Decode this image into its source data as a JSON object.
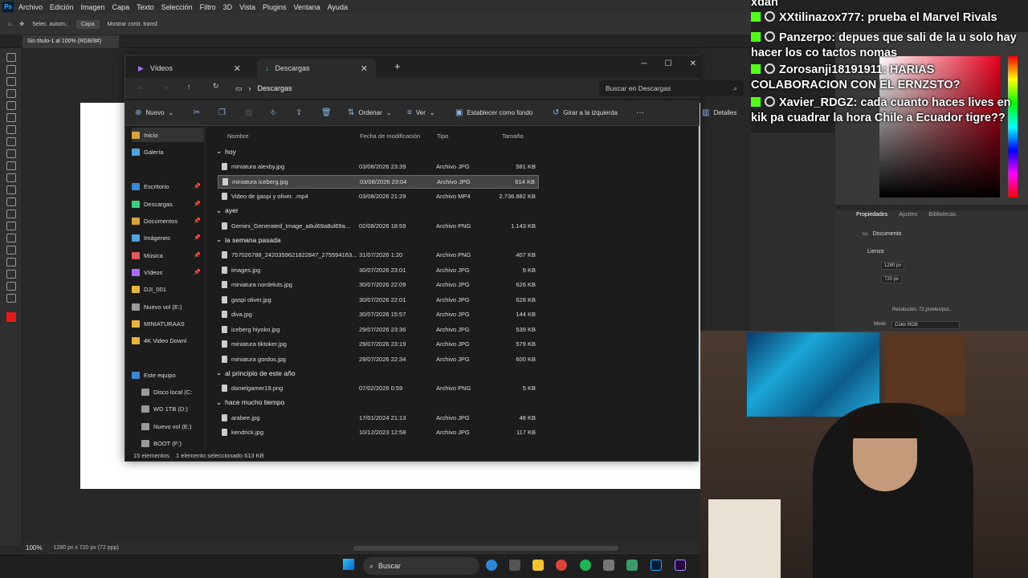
{
  "photoshop": {
    "menu": [
      "Archivo",
      "Edición",
      "Imagen",
      "Capa",
      "Texto",
      "Selección",
      "Filtro",
      "3D",
      "Vista",
      "Plugins",
      "Ventana",
      "Ayuda"
    ],
    "options": {
      "auto_select": "Selec. autom.:",
      "layer_select": "Capa",
      "show_transform": "Mostrar contr. transf."
    },
    "doc_tab": "Sin título-1 al 100% (RGB/8#)",
    "status_zoom": "100%",
    "status_info": "1280 px x 720 px (72 ppp)",
    "properties": {
      "tabs": [
        "Propiedades",
        "Ajustes",
        "Bibliotecas"
      ],
      "document": "Documento",
      "canvas": "Lienzo",
      "width": "1280 px",
      "height": "720 px",
      "resolution": "Resolución: 72 píxeles/pul...",
      "mode_label": "Modo",
      "mode_value": "Color RGB"
    }
  },
  "explorer": {
    "tabs": [
      {
        "label": "Vídeos"
      },
      {
        "label": "Descargas"
      }
    ],
    "breadcrumb": "Descargas",
    "search_placeholder": "Buscar en Descargas",
    "commands": {
      "new": "Nuevo",
      "sort": "Ordenar",
      "view": "Ver",
      "set_background": "Establecer como fondo",
      "rotate_left": "Girar a la izquierda",
      "details": "Detalles"
    },
    "nav": [
      {
        "label": "Inicio",
        "pin": false
      },
      {
        "label": "Galería",
        "pin": false
      },
      {
        "label": "Escritorio",
        "pin": true
      },
      {
        "label": "Descargas",
        "pin": true
      },
      {
        "label": "Documentos",
        "pin": true
      },
      {
        "label": "Imágenes",
        "pin": true
      },
      {
        "label": "Música",
        "pin": true
      },
      {
        "label": "Vídeos",
        "pin": true
      },
      {
        "label": "DJI_001",
        "pin": false
      },
      {
        "label": "Nuevo vol (E:)",
        "pin": false
      },
      {
        "label": "MINIATURAAS",
        "pin": false
      },
      {
        "label": "4K Video Downl",
        "pin": false
      },
      {
        "label": "Este equipo",
        "pin": false
      },
      {
        "label": "Disco local (C:",
        "pin": false
      },
      {
        "label": "WD 1TB (D:)",
        "pin": false
      },
      {
        "label": "Nuevo vol (E:)",
        "pin": false
      },
      {
        "label": "BOOT (F:)",
        "pin": false
      }
    ],
    "columns": {
      "name": "Nombre",
      "date": "Fecha de modificación",
      "type": "Tipo",
      "size": "Tamaño"
    },
    "groups": [
      {
        "label": "hoy",
        "files": [
          {
            "name": "miniatura alexby.jpg",
            "date": "03/08/2026 23:39",
            "type": "Archivo JPG",
            "size": "581 KB"
          },
          {
            "name": "miniatura iceberg.jpg",
            "date": "03/08/2026 23:04",
            "type": "Archivo JPG",
            "size": "614 KB"
          },
          {
            "name": "Video de gaspi y oliver. .mp4",
            "date": "03/08/2026 21:29",
            "type": "Archivo MP4",
            "size": "2.736.882 KB"
          }
        ]
      },
      {
        "label": "ayer",
        "files": [
          {
            "name": "Gemini_Generated_Image_a8ul69a8ul69a...",
            "date": "02/08/2026 18:59",
            "type": "Archivo PNG",
            "size": "1.143 KB"
          }
        ]
      },
      {
        "label": "la semana pasada",
        "files": [
          {
            "name": "757026788_2420359621822847_275594163...",
            "date": "31/07/2026 1:20",
            "type": "Archivo PNG",
            "size": "407 KB"
          },
          {
            "name": "images.jpg",
            "date": "30/07/2026 23:01",
            "type": "Archivo JPG",
            "size": "9 KB"
          },
          {
            "name": "miniatura nordeluts.jpg",
            "date": "30/07/2026 22:09",
            "type": "Archivo JPG",
            "size": "626 KB"
          },
          {
            "name": "gaspi oliver.jpg",
            "date": "30/07/2026 22:01",
            "type": "Archivo JPG",
            "size": "628 KB"
          },
          {
            "name": "diva.jpg",
            "date": "30/07/2026 15:57",
            "type": "Archivo JPG",
            "size": "144 KB"
          },
          {
            "name": "iceberg hiyoko.jpg",
            "date": "29/07/2026 23:36",
            "type": "Archivo JPG",
            "size": "539 KB"
          },
          {
            "name": "miniatura tiktoker.jpg",
            "date": "29/07/2026 23:19",
            "type": "Archivo JPG",
            "size": "579 KB"
          },
          {
            "name": "miniatura gordos.jpg",
            "date": "29/07/2026 22:34",
            "type": "Archivo JPG",
            "size": "600 KB"
          }
        ]
      },
      {
        "label": "al principio de este año",
        "files": [
          {
            "name": "danielgamer19.png",
            "date": "07/02/2026 0:59",
            "type": "Archivo PNG",
            "size": "5 KB"
          }
        ]
      },
      {
        "label": "hace mucho tiempo",
        "files": [
          {
            "name": "arabee.jpg",
            "date": "17/01/2024 21:13",
            "type": "Archivo JPG",
            "size": "48 KB"
          },
          {
            "name": "kendrick.jpg",
            "date": "10/12/2023 12:58",
            "type": "Archivo JPG",
            "size": "117 KB"
          }
        ]
      }
    ],
    "status": {
      "count": "15 elementos",
      "selection": "1 elemento seleccionado  613 KB"
    }
  },
  "chat": [
    {
      "text": "xdan",
      "badges": false
    },
    {
      "text": "XXtilinazox777: prueba el Marvel Rivals",
      "badges": true
    },
    {
      "text": "Panzerpo: depues que sali de la u solo hay hacer los co tactos nomas",
      "badges": true
    },
    {
      "text": "Zorosanji18191911: HARIAS COLABORACION CON EL ERNZSTO?",
      "badges": true
    },
    {
      "text": "Xavier_RDGZ: cada cuanto haces lives en kik pa cuadrar la hora Chile a Ecuador tigre??",
      "badges": true
    }
  ],
  "taskbar": {
    "search": "Buscar"
  }
}
